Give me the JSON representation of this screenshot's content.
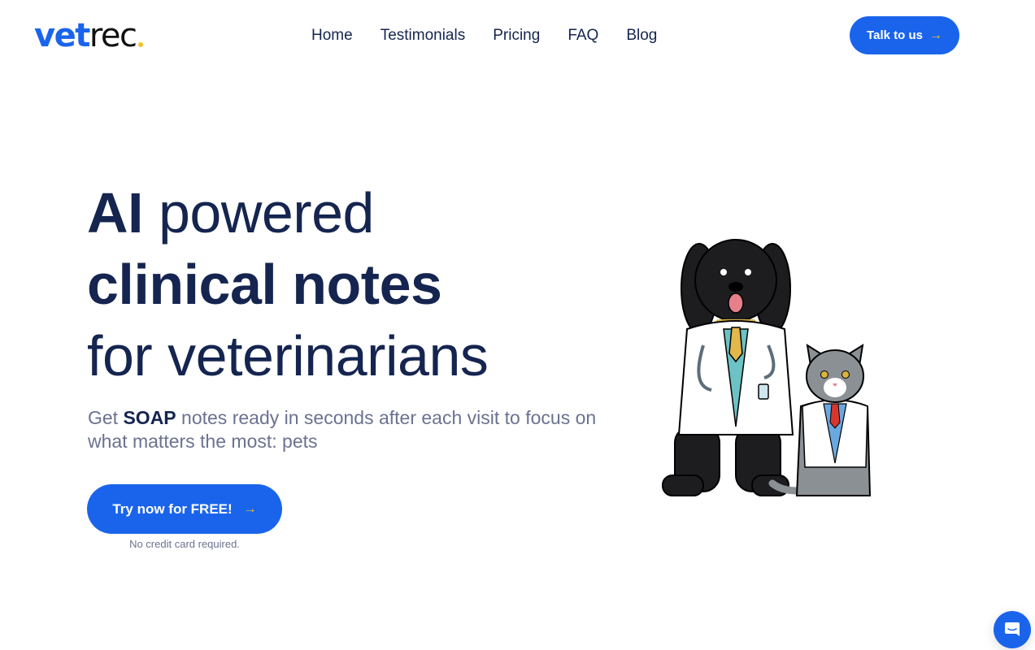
{
  "brand": {
    "logo_part1": "vet",
    "logo_part2": "rec",
    "accent_color": "#1a64ec",
    "dot_color": "#f5c025"
  },
  "nav": {
    "links": [
      {
        "label": "Home"
      },
      {
        "label": "Testimonials"
      },
      {
        "label": "Pricing"
      },
      {
        "label": "FAQ"
      },
      {
        "label": "Blog"
      }
    ],
    "cta_label": "Talk to us",
    "cta_icon": "arrow-right-icon"
  },
  "hero": {
    "line1_bold": "AI",
    "line1_light": " powered",
    "line2_bold": "clinical notes",
    "line3_light": "for veterinarians",
    "subtitle_pre": "Get ",
    "subtitle_bold": "SOAP",
    "subtitle_post": " notes ready in seconds after each visit to focus on what matters the most: pets",
    "cta_label": "Try now for FREE!",
    "cta_icon": "arrow-right-icon",
    "cta_note": "No credit card required.",
    "illustration": "dog-and-cat-veterinarians-illustration"
  },
  "chat": {
    "icon": "chat-bubble-icon"
  }
}
